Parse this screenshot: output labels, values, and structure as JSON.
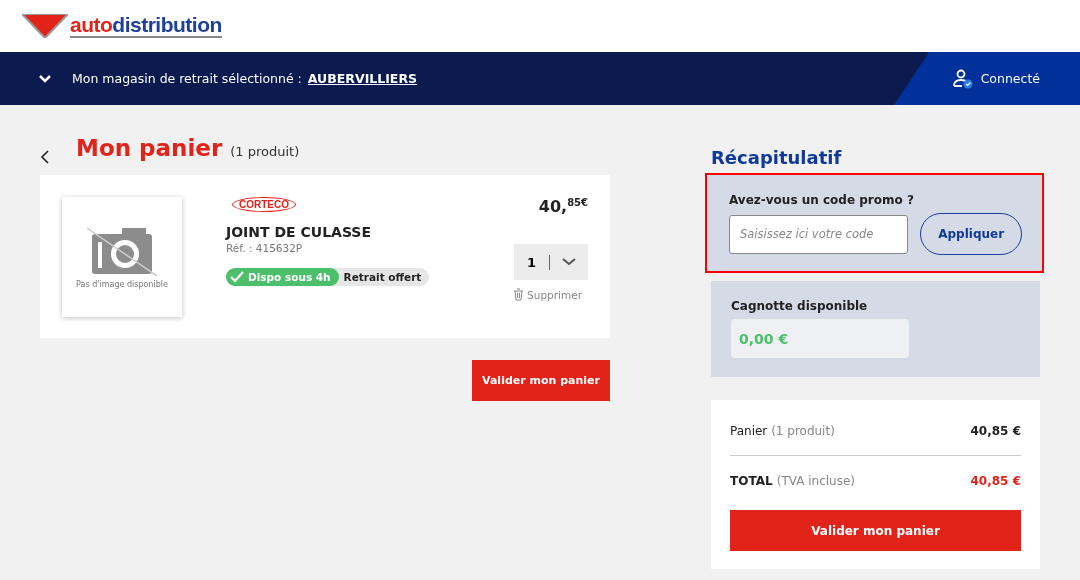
{
  "logo": {
    "part_1": "auto",
    "part_2": "distribution"
  },
  "store_bar": {
    "label": "Mon magasin de retrait sélectionné :",
    "store": "AUBERVILLIERS",
    "account": "Connecté"
  },
  "cart": {
    "title": "Mon panier",
    "count": "(1 produit)",
    "items": [
      {
        "image_note": "Pas d'image disponible",
        "brand": "CORTECO",
        "name": "JOINT DE CULASSE",
        "ref": "Réf. : 415632P",
        "availability": "Dispo sous 4h",
        "pickup": "Retrait offert",
        "price": "40,$^{85€}$",
        "quantity": "1",
        "remove": "Supprimer"
      }
    ],
    "validate": "Valider mon panier"
  },
  "summary": {
    "title": "Récapitulatif",
    "promo": {
      "label": "Avez-vous un code promo ?",
      "placeholder": "Saisissez ici votre code",
      "button": "Appliquer",
      "highlighted": true
    },
    "kitty": {
      "label": "Cagnotte disponible",
      "value": "0,00 €"
    },
    "lines": [
      {
        "kind": "subtotal",
        "label": "Panier",
        "note": "(1 produit)",
        "amount": "40,85 €"
      },
      {
        "kind": "total",
        "label": "TOTAL",
        "note": "(TVA incluse)",
        "amount": "40,85 €"
      }
    ],
    "validate": "Valider mon panier"
  }
}
